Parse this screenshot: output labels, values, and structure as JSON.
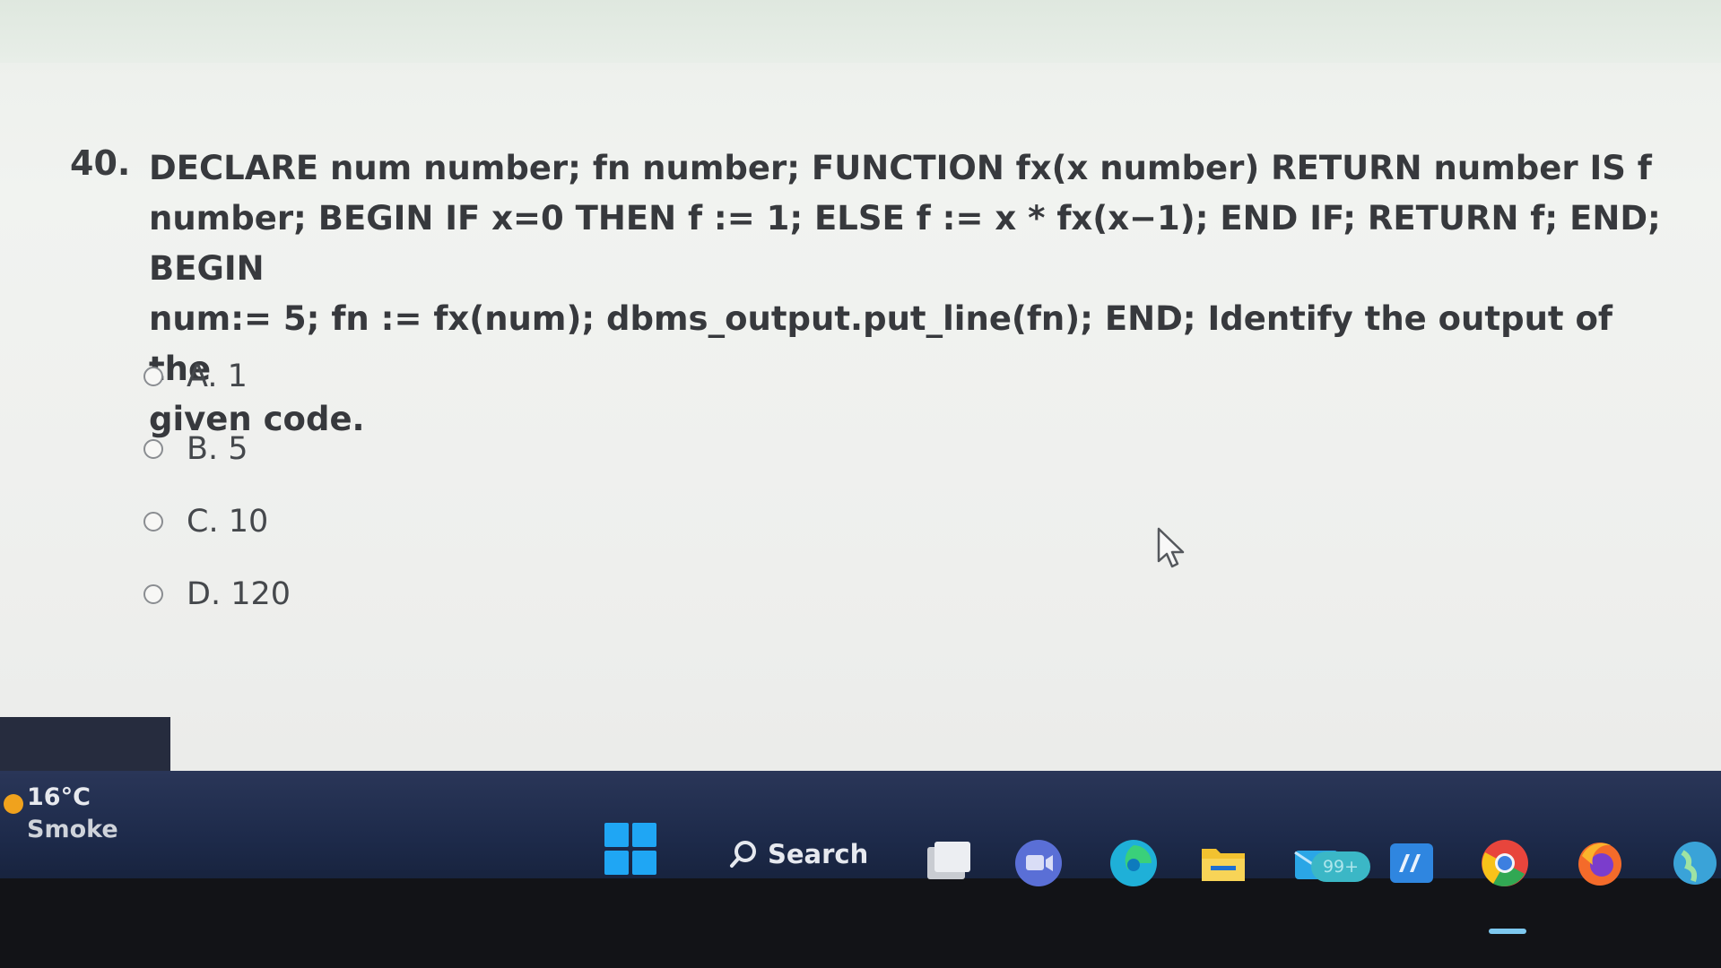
{
  "question": {
    "number": "40.",
    "text": "DECLARE num number; fn number; FUNCTION fx(x number) RETURN number IS f\nnumber; BEGIN IF x=0 THEN f := 1; ELSE f := x * fx(x−1); END IF; RETURN f; END; BEGIN\nnum:= 5; fn := fx(num); dbms_output.put_line(fn); END; Identify the output of the\ngiven code.",
    "options": [
      {
        "label": "A. 1"
      },
      {
        "label": "B. 5"
      },
      {
        "label": "C. 10"
      },
      {
        "label": "D. 120"
      }
    ]
  },
  "taskbar": {
    "weather": {
      "temperature": "16°C",
      "condition": "Smoke"
    },
    "search_label": "Search",
    "mail_badge": "99+",
    "icons": [
      "windows-start-icon",
      "search-icon",
      "file-explorer-window-icon",
      "teams-meet-icon",
      "edge-icon",
      "folder-icon",
      "mail-icon",
      "app-tile-icon",
      "chrome-icon",
      "firefox-icon",
      "globe-icon"
    ]
  },
  "colors": {
    "taskbar": "#1d2a4a",
    "start_accent": "#1fa6f4",
    "question_text": "#37393d"
  }
}
